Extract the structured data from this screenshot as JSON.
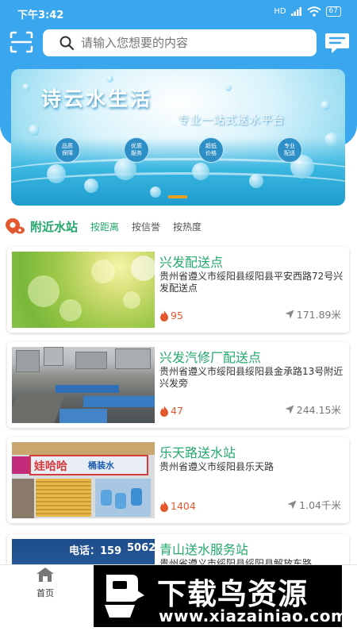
{
  "status_bar": {
    "time": "下午3:42",
    "network": "HD",
    "battery": "67"
  },
  "search": {
    "placeholder": "请输入您想要的内容"
  },
  "banner": {
    "title": "诗云水生活",
    "subtitle": "专业一站式送水平台",
    "badges": [
      {
        "line1": "品质",
        "line2": "保障"
      },
      {
        "line1": "优质",
        "line2": "服务"
      },
      {
        "line1": "超低",
        "line2": "价格"
      },
      {
        "line1": "专业",
        "line2": "配送"
      }
    ]
  },
  "section": {
    "title": "附近水站",
    "tabs": [
      "按距离",
      "按信誉",
      "按热度"
    ],
    "active_tab": "按距离"
  },
  "stations": [
    {
      "name": "兴发配送点",
      "address": "贵州省遵义市绥阳县绥阳县平安西路72号兴发配送点",
      "heat": "95",
      "distance": "171.89米"
    },
    {
      "name": "兴发汽修厂配送点",
      "address": "贵州省遵义市绥阳县绥阳县金承路13号附近兴发旁",
      "heat": "47",
      "distance": "244.15米"
    },
    {
      "name": "乐天路送水站",
      "address": "贵州省遵义市绥阳县乐天路",
      "heat": "1404",
      "distance": "1.04千米"
    },
    {
      "name": "青山送水服务站",
      "address": "贵州省遵义市绥阳县绥阳县解放东路",
      "heat": "",
      "distance": ""
    }
  ],
  "store_signs": {
    "sign1": "电话：159",
    "sign1_b": "5062",
    "storefront": "娃哈哈",
    "storefront_b": "桶装水"
  },
  "bottom_nav": {
    "home_label": "首页"
  },
  "watermark": {
    "title": "下载鸟资源",
    "url": "www.xiazainiao.com"
  },
  "colors": {
    "header_blue": "#3aa6ee",
    "accent_green": "#24a86c",
    "heat_orange": "#e4572e"
  }
}
